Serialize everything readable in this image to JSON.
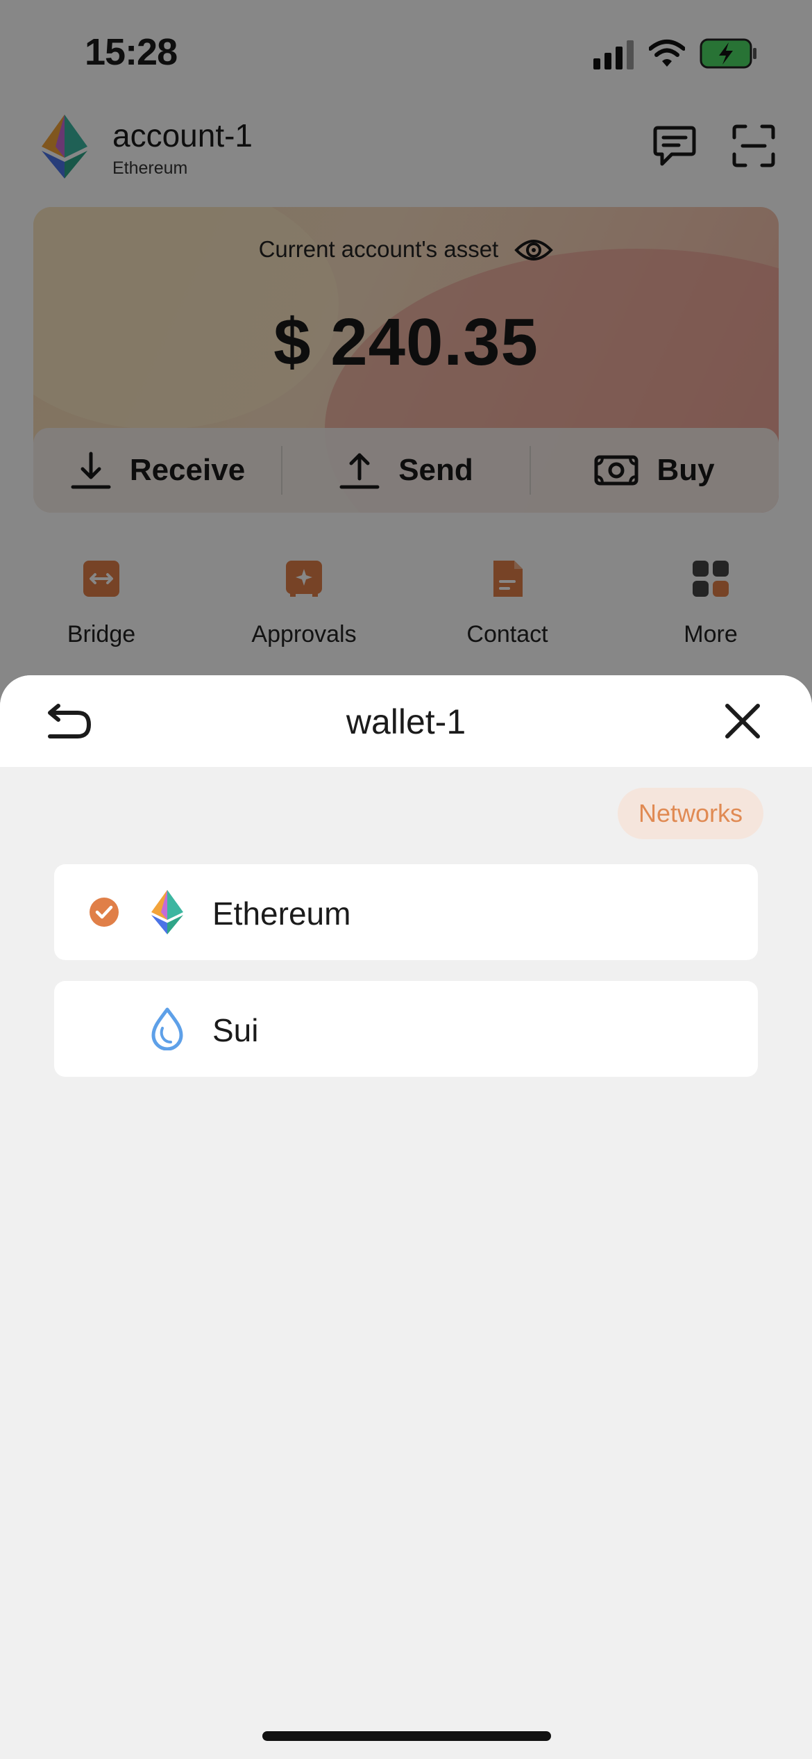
{
  "status_bar": {
    "time": "15:28"
  },
  "header": {
    "account_name": "account-1",
    "network": "Ethereum"
  },
  "asset_card": {
    "title": "Current account's asset",
    "value": "$ 240.35",
    "actions": [
      {
        "label": "Receive",
        "icon": "download-icon"
      },
      {
        "label": "Send",
        "icon": "upload-icon"
      },
      {
        "label": "Buy",
        "icon": "cash-icon"
      }
    ]
  },
  "quick_actions": [
    {
      "label": "Bridge",
      "icon": "bridge-icon"
    },
    {
      "label": "Approvals",
      "icon": "approvals-icon"
    },
    {
      "label": "Contact",
      "icon": "document-icon"
    },
    {
      "label": "More",
      "icon": "grid-icon"
    }
  ],
  "sheet": {
    "title": "wallet-1",
    "chip_label": "Networks",
    "networks": [
      {
        "name": "Ethereum",
        "selected": true,
        "icon": "ethereum-logo-icon"
      },
      {
        "name": "Sui",
        "selected": false,
        "icon": "sui-logo-icon"
      }
    ]
  },
  "colors": {
    "accent": "#e07f48",
    "chip_bg": "#f5e5dc",
    "sheet_bg": "#f0f0f0"
  }
}
